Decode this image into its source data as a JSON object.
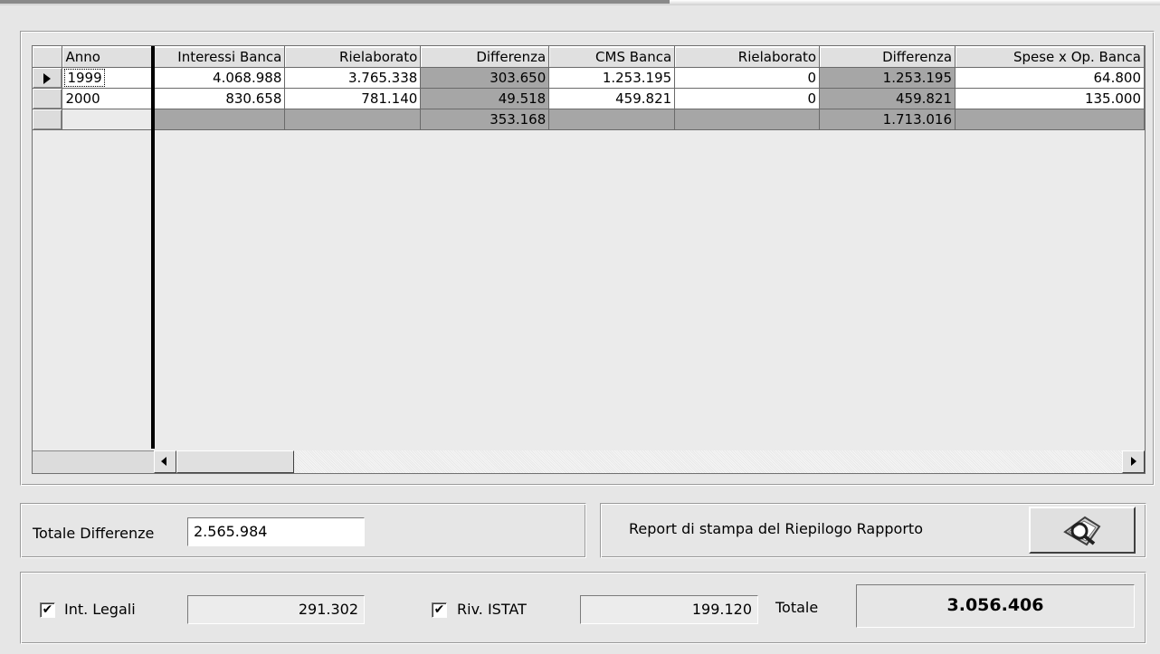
{
  "grid": {
    "columns": [
      "Anno",
      "Interessi Banca",
      "Rielaborato",
      "Differenza",
      "CMS Banca",
      "Rielaborato",
      "Differenza",
      "Spese x Op. Banca"
    ],
    "rows": [
      [
        "1999",
        "4.068.988",
        "3.765.338",
        "303.650",
        "1.253.195",
        "0",
        "1.253.195",
        "64.800"
      ],
      [
        "2000",
        "830.658",
        "781.140",
        "49.518",
        "459.821",
        "0",
        "459.821",
        "135.000"
      ]
    ],
    "totals": [
      "",
      "",
      "",
      "353.168",
      "",
      "",
      "1.713.016",
      ""
    ]
  },
  "summary": {
    "totale_differenze_label": "Totale Differenze",
    "totale_differenze_value": "2.565.984",
    "report_label": "Report di stampa del Riepilogo Rapporto"
  },
  "footer": {
    "int_legali_label": "Int. Legali",
    "int_legali_checked": "✔",
    "int_legali_value": "291.302",
    "riv_istat_label": "Riv. ISTAT",
    "riv_istat_checked": "✔",
    "riv_istat_value": "199.120",
    "totale_label": "Totale",
    "totale_value": "3.056.406"
  },
  "icons": {
    "report_button_icon": "magnifier-print-icon",
    "row_pointer_icon": "row-pointer-icon"
  },
  "colors": {
    "shaded_cell": "#a6a6a6",
    "window_bg": "#e6e6e6"
  }
}
